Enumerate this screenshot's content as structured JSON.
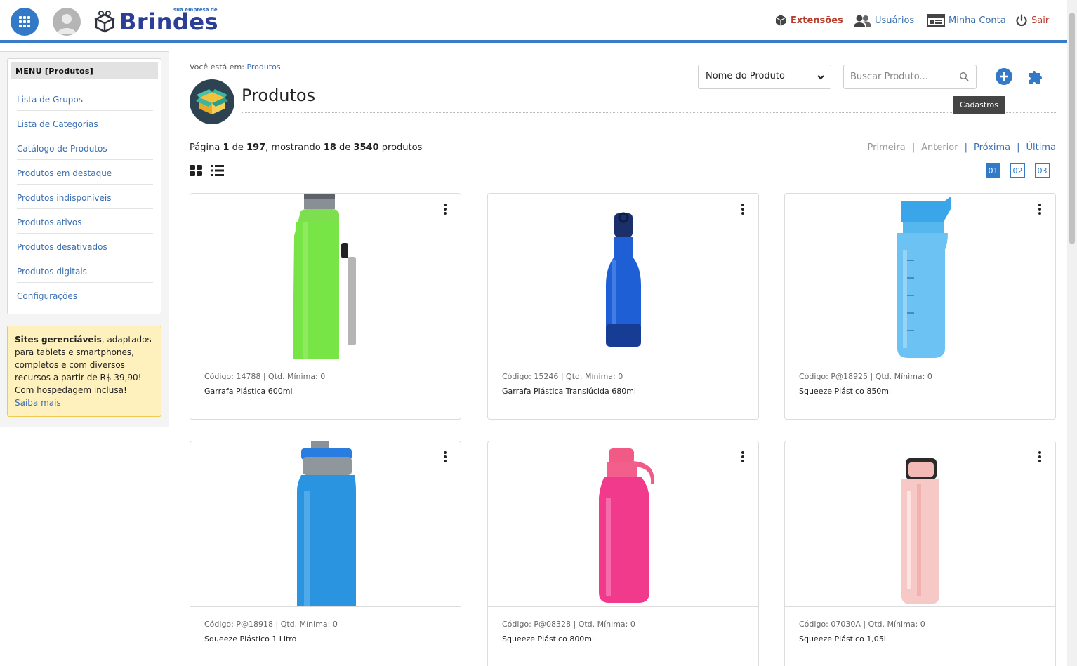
{
  "header": {
    "logo_word": "Brindes",
    "logo_tagline": "sua empresa de",
    "nav": {
      "extensions": "Extensões",
      "users": "Usuários",
      "account": "Minha Conta",
      "logout": "Sair"
    }
  },
  "sidebar": {
    "menu_title": "MENU [Produtos]",
    "items": [
      {
        "label": "Lista de Grupos"
      },
      {
        "label": "Lista de Categorias"
      },
      {
        "label": "Catálogo de Produtos"
      },
      {
        "label": "Produtos em destaque"
      },
      {
        "label": "Produtos indisponíveis"
      },
      {
        "label": "Produtos ativos"
      },
      {
        "label": "Produtos desativados"
      },
      {
        "label": "Produtos digitais"
      },
      {
        "label": "Configurações"
      }
    ],
    "promo": {
      "bold": "Sites gerenciáveis",
      "text": ", adaptados para tablets e smartphones, completos e com diversos recursos a partir de R$ 39,90! Com hospedagem inclusa!",
      "link": "Saiba mais"
    }
  },
  "main": {
    "breadcrumb_prefix": "Você está em:",
    "breadcrumb_link": "Produtos",
    "title": "Produtos",
    "filter_select_value": "Nome do Produto",
    "search_placeholder": "Buscar Produto...",
    "tooltip": "Cadastros",
    "pager": {
      "label_page": "Página",
      "current_page": "1",
      "label_of": "de",
      "total_pages": "197",
      "label_showing": ", mostrando",
      "shown": "18",
      "label_of2": "de",
      "total_products": "3540",
      "label_products": "produtos",
      "first": "Primeira",
      "previous": "Anterior",
      "next": "Próxima",
      "last": "Última",
      "sep": "|",
      "pages": [
        "01",
        "02",
        "03"
      ]
    }
  },
  "products": [
    {
      "meta": "Código: 14788  |  Qtd. Mínima: 0",
      "name": "Garrafa Plástica 600ml",
      "color": "#6fdc3c"
    },
    {
      "meta": "Código: 15246  |  Qtd. Mínima: 0",
      "name": "Garrafa Plástica Translúcida 680ml",
      "color": "#1f5fd6"
    },
    {
      "meta": "Código: P@18925  |  Qtd. Mínima: 0",
      "name": "Squeeze Plástico 850ml",
      "color": "#56b6ee"
    },
    {
      "meta": "Código: P@18918  |  Qtd. Mínima: 0",
      "name": "Squeeze Plástico 1 Litro",
      "color": "#2a94e0"
    },
    {
      "meta": "Código: P@08328  |  Qtd. Mínima: 0",
      "name": "Squeeze Plástico 800ml",
      "color": "#f23a8c"
    },
    {
      "meta": "Código: 07030A  |  Qtd. Mínima: 0",
      "name": "Squeeze Plástico 1,05L",
      "color": "#f6c6c4"
    }
  ]
}
